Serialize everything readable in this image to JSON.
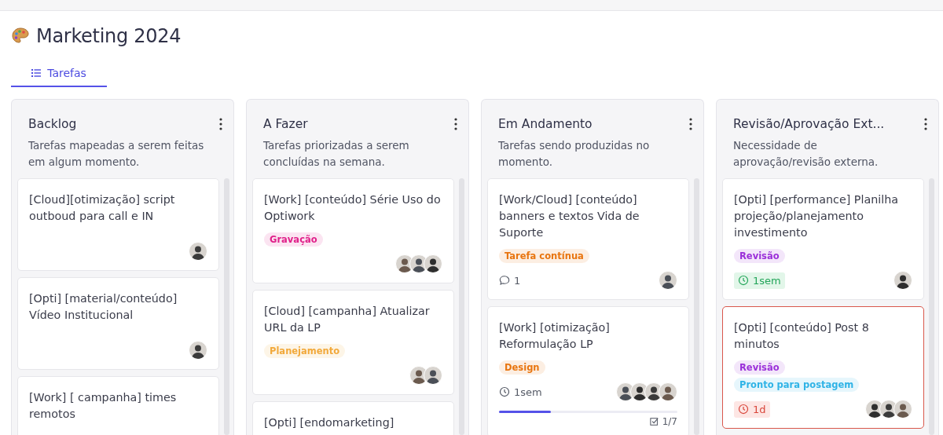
{
  "project": {
    "title": "Marketing 2024"
  },
  "tabs": [
    {
      "label": "Tarefas",
      "selected": true
    }
  ],
  "columns": [
    {
      "name": "Backlog",
      "description": "Tarefas mapeadas a serem feitas em algum momento.",
      "cards": [
        {
          "title": "[Cloud][otimização] script outboud para call e IN",
          "highlighted": false,
          "avatars": [
            {
              "kind": "person"
            }
          ]
        },
        {
          "title": "[Opti] [material/conteúdo] Vídeo Institucional",
          "highlighted": false,
          "avatars": [
            {
              "kind": "person"
            }
          ]
        },
        {
          "title": "[Work] [ campanha] times remotos",
          "highlighted": false
        }
      ]
    },
    {
      "name": "A Fazer",
      "description": "Tarefas priorizadas a serem concluídas na semana.",
      "cards": [
        {
          "title": "[Work] [conteúdo] Série Uso do Optiwork",
          "highlighted": false,
          "tags": [
            {
              "label": "Gravação",
              "color": "#e0218a"
            }
          ],
          "avatars": [
            {
              "kind": "person"
            },
            {
              "kind": "person"
            },
            {
              "kind": "person"
            }
          ]
        },
        {
          "title": "[Cloud] [campanha] Atualizar URL da LP",
          "highlighted": false,
          "tags": [
            {
              "label": "Planejamento",
              "color": "#f2a93b"
            }
          ],
          "avatars": [
            {
              "kind": "person"
            },
            {
              "kind": "person"
            }
          ]
        },
        {
          "title": "[Opti] [endomarketing]",
          "highlighted": false
        }
      ]
    },
    {
      "name": "Em Andamento",
      "description": "Tarefas sendo produzidas no momento.",
      "cards": [
        {
          "title": "[Work/Cloud] [conteúdo] banners e textos Vida de Suporte",
          "highlighted": false,
          "tags": [
            {
              "label": "Tarefa contínua",
              "color": "#e8750f"
            }
          ],
          "comments": "1",
          "avatars": [
            {
              "kind": "person"
            }
          ]
        },
        {
          "title": "[Work] [otimização] Reformulação LP",
          "highlighted": false,
          "tags": [
            {
              "label": "Design",
              "color": "#e8750f"
            }
          ],
          "due": {
            "text": "1sem",
            "kind": "plain"
          },
          "avatars": [
            {
              "kind": "person"
            },
            {
              "kind": "person"
            },
            {
              "kind": "person"
            },
            {
              "kind": "person"
            }
          ],
          "progress": {
            "level": 0.29,
            "checklist": "1/7"
          }
        }
      ]
    },
    {
      "name": "Revisão/Aprovação Ext...",
      "description": "Necessidade de aprovação/revisão externa.",
      "cards": [
        {
          "title": "[Opti] [performance] Planilha projeção/planejamento investimento",
          "highlighted": false,
          "tags": [
            {
              "label": "Revisão",
              "color": "#9b30d9"
            }
          ],
          "due": {
            "text": "1sem",
            "kind": "ok"
          },
          "avatars": [
            {
              "kind": "person"
            }
          ]
        },
        {
          "title": "[Opti] [conteúdo] Post 8 minutos",
          "highlighted": true,
          "tags": [
            {
              "label": "Revisão",
              "color": "#9b30d9"
            },
            {
              "label": "Pronto para postagem",
              "color": "#2fb3e6"
            }
          ],
          "due": {
            "text": "1d",
            "kind": "overdue"
          },
          "avatars": [
            {
              "kind": "person"
            },
            {
              "kind": "person"
            },
            {
              "kind": "person"
            }
          ]
        }
      ]
    }
  ]
}
